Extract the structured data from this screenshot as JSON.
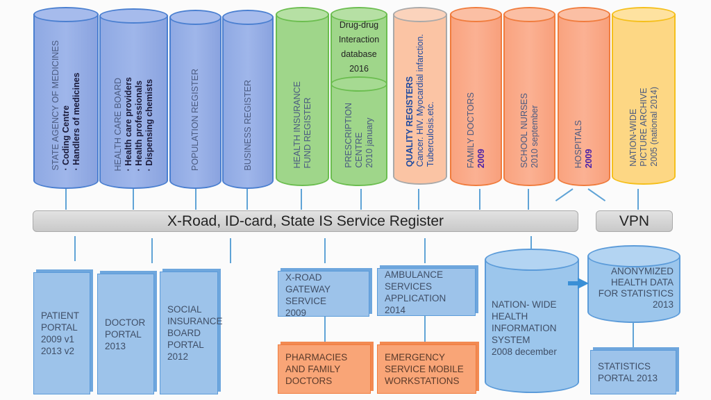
{
  "top_registers": [
    {
      "title": "STATE AGENCY OF MEDICINES",
      "items": [
        "· Coding Centre",
        "· Handlers of medicines"
      ]
    },
    {
      "title": "HEALTH CARE BOARD",
      "items": [
        "· Health care providers",
        "· Health professionals",
        "· Dispensing chemists"
      ]
    },
    {
      "title": "POPULATION REGISTER"
    },
    {
      "title": "BUSINESS REGISTER"
    },
    {
      "title": "HEALTH INSURANCE",
      "line2": "FUND REGISTER"
    },
    {
      "title": "PRESCRIPTION",
      "line2": "CENTRE",
      "line3": "2010 january",
      "cap": [
        "Drug-drug",
        "Interaction",
        "database",
        "2016"
      ]
    },
    {
      "title": "QUALITY REGISTERS",
      "line2": "Cancer. HIV. Myocardial infarction.",
      "line3": "Tuberculosis.etc."
    },
    {
      "title": "FAMILY DOCTORS",
      "year": "2009"
    },
    {
      "title": "SCHOOL NURSES",
      "line2": "2010 september"
    },
    {
      "title": "HOSPITALS",
      "year": "2009"
    },
    {
      "title": "NATION-WIDE",
      "line2": "PICTURE ARCHIVE",
      "line3": "2005 (national 2014)"
    }
  ],
  "bus": {
    "main": "X-Road, ID-card, State IS Service Register",
    "vpn": "VPN"
  },
  "bottom": {
    "patient": "PATIENT\nPORTAL\n2009 v1\n2013 v2",
    "doctor": "DOCTOR\nPORTAL\n2013",
    "social": "SOCIAL\nINSURANCE\nBOARD\nPORTAL\n2012",
    "xroad": "X-ROAD\nGATEWAY\nSERVICE\n2009",
    "ambulance": "AMBULANCE\nSERVICES\nAPPLICATION\n2014",
    "pharmacies": "PHARMACIES\nAND FAMILY\nDOCTORS",
    "emergency": "EMERGENCY\nSERVICE MOBILE\nWORKSTATIONS",
    "nationwide": "NATION- WIDE\nHEALTH\nINFORMATION\nSYSTEM\n2008 december",
    "anonymized": "ANONYMIZED\nHEALTH DATA\nFOR STATISTICS\n2013",
    "statistics": "STATISTICS\nPORTAL 2013"
  }
}
